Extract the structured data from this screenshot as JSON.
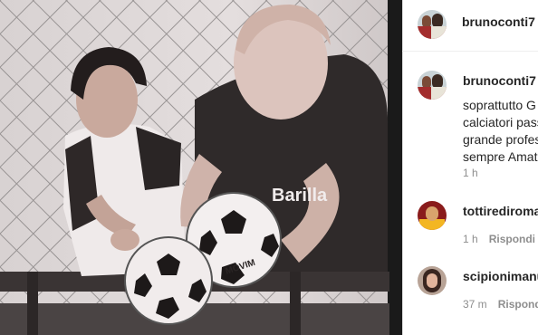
{
  "post": {
    "author": "brunoconti7",
    "caption_author": "brunoconti7",
    "caption_lines": [
      "soprattutto G",
      "calciatori pass",
      "grande profes",
      "sempre Amat"
    ],
    "caption_time": "1 h",
    "photo_text": {
      "shirt_brand": "Barilla",
      "ball_text": "MOVIM"
    }
  },
  "comments": [
    {
      "username": "tottirediroma",
      "time": "1 h",
      "reply_label": "Rispondi"
    },
    {
      "username": "scipionimanu",
      "time": "37 m",
      "reply_label": "Rispondi"
    }
  ]
}
